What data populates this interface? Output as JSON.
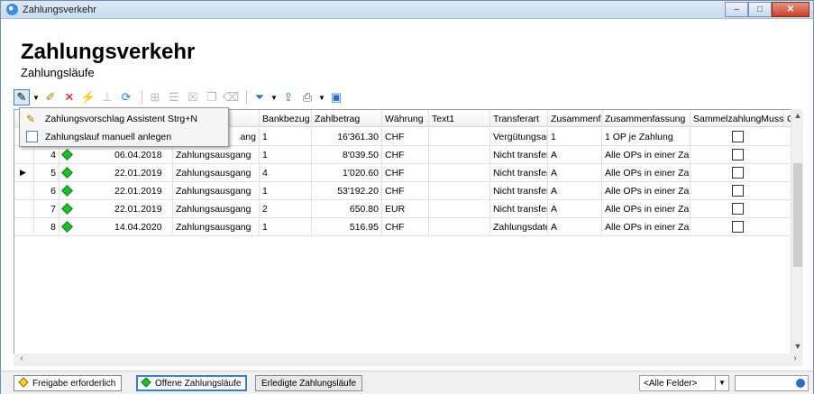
{
  "window": {
    "title": "Zahlungsverkehr",
    "controls": {
      "minimize": "–",
      "maximize": "□",
      "close": "✕"
    }
  },
  "header": {
    "title": "Zahlungsverkehr",
    "subtitle": "Zahlungsläufe"
  },
  "toolbar": {
    "icons": [
      "wizard-icon",
      "dropdown-arrow",
      "edit-icon",
      "delete-icon",
      "flash-icon",
      "split-icon",
      "refresh-icon",
      "add-disabled",
      "edit-disabled",
      "delete-disabled",
      "copy-disabled",
      "eraser-disabled",
      "filter-icon",
      "export-icon",
      "print-icon",
      "save-icon"
    ]
  },
  "menu": {
    "items": [
      {
        "label": "Zahlungsvorschlag Assistent Strg+N",
        "icon": "wizard-icon"
      },
      {
        "label": "Zahlungslauf manuell anlegen",
        "icon": "document-icon"
      }
    ]
  },
  "grid": {
    "columns": [
      "",
      "",
      "",
      "",
      "Bankbezug",
      "Zahlbetrag",
      "Währung",
      "Text1",
      "Transferart",
      "Zusammenfa",
      "Zusammenfassung",
      "SammelzahlungMuss",
      "Glae"
    ],
    "rows": [
      {
        "nr": "",
        "date": "",
        "type": "ang",
        "bank": "1",
        "amount": "16'361.30",
        "currency": "CHF",
        "text1": "",
        "transfer": "Vergütungsau",
        "zus1": "1",
        "zus": "1 OP je Zahlung",
        "selected": false
      },
      {
        "nr": "4",
        "date": "06.04.2018",
        "type": "Zahlungsausgang",
        "bank": "1",
        "amount": "8'039.50",
        "currency": "CHF",
        "text1": "",
        "transfer": "Nicht transfer",
        "zus1": "A",
        "zus": "Alle OPs in einer Zah",
        "selected": false
      },
      {
        "nr": "5",
        "date": "22.01.2019",
        "type": "Zahlungsausgang",
        "bank": "4",
        "amount": "1'020.60",
        "currency": "CHF",
        "text1": "",
        "transfer": "Nicht transfer",
        "zus1": "A",
        "zus": "Alle OPs in einer Zah",
        "selected": true
      },
      {
        "nr": "6",
        "date": "22.01.2019",
        "type": "Zahlungsausgang",
        "bank": "1",
        "amount": "53'192.20",
        "currency": "CHF",
        "text1": "",
        "transfer": "Nicht transfer",
        "zus1": "A",
        "zus": "Alle OPs in einer Zah",
        "selected": false
      },
      {
        "nr": "7",
        "date": "22.01.2019",
        "type": "Zahlungsausgang",
        "bank": "2",
        "amount": "650.80",
        "currency": "EUR",
        "text1": "",
        "transfer": "Nicht transfer",
        "zus1": "A",
        "zus": "Alle OPs in einer Zah",
        "selected": false
      },
      {
        "nr": "8",
        "date": "14.04.2020",
        "type": "Zahlungsausgang",
        "bank": "1",
        "amount": "516.95",
        "currency": "CHF",
        "text1": "",
        "transfer": "Zahlungsdate",
        "zus1": "A",
        "zus": "Alle OPs in einer Zah",
        "selected": false
      }
    ]
  },
  "bottom_tabs": [
    {
      "label": "Freigabe erforderlich",
      "icon": "yellow-diamond-icon"
    },
    {
      "label": "Offene Zahlungsläufe",
      "icon": "green-diamond-icon"
    },
    {
      "label": "Erledigte Zahlungsläufe",
      "icon": ""
    }
  ],
  "filter": {
    "value": "<Alle Felder>"
  },
  "colors": {
    "accent": "#3b7fc4",
    "green": "#1fbf2b",
    "yellow": "#f7d530"
  }
}
